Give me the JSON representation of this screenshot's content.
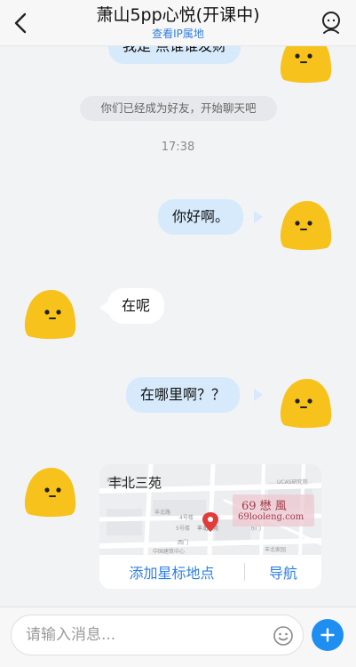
{
  "header": {
    "title": "萧山5pp心悦(开课中)",
    "subtitle": "查看IP属地"
  },
  "chat": {
    "partial_bubble_text": "我是 点谁谁发财",
    "system_notice": "你们已经成为好友，开始聊天吧",
    "time": "17:38",
    "messages": [
      {
        "side": "right",
        "text": "你好啊。"
      },
      {
        "side": "left",
        "text": "在呢"
      },
      {
        "side": "right",
        "text": "在哪里啊？？"
      }
    ]
  },
  "map_card": {
    "place_name": "丰北三苑",
    "star_label": "添加星标地点",
    "nav_label": "导航",
    "map_labels": [
      "地铁站",
      "丰北路",
      "4号楼",
      "5号楼",
      "西门",
      "东门",
      "丰北家园",
      "丰北三苑",
      "UCAS研究院",
      "中国建筑中心"
    ],
    "watermark_title": "69 懋 風",
    "watermark_url": "69looleng.com"
  },
  "input": {
    "placeholder": "请输入消息..."
  },
  "colors": {
    "accent": "#2f7fe0",
    "bubble_right": "#d6eafb",
    "avatar_yellow": "#f6c21b",
    "add_button": "#1e8ef0"
  }
}
